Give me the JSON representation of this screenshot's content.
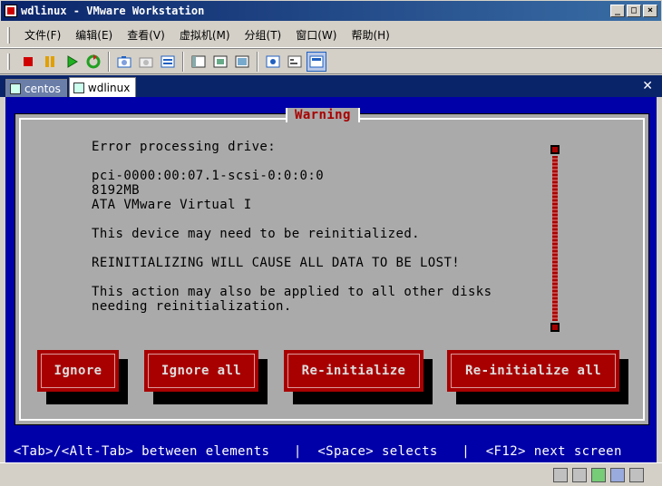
{
  "window": {
    "title": "wdlinux - VMware Workstation",
    "controls": [
      "_",
      "□",
      "×"
    ]
  },
  "menu": [
    "文件(F)",
    "编辑(E)",
    "查看(V)",
    "虚拟机(M)",
    "分组(T)",
    "窗口(W)",
    "帮助(H)"
  ],
  "toolbar": {
    "icons": [
      "power-off-icon",
      "suspend-icon",
      "power-on-icon",
      "reset-icon",
      "snapshot-icon",
      "revert-snapshot-icon",
      "snapshot-manager-icon",
      "normal-view-icon",
      "fullscreen-icon",
      "quick-switch-icon",
      "console-view-icon",
      "summary-view-icon",
      "appliance-view-icon"
    ]
  },
  "tabs": [
    {
      "label": "centos",
      "active": false
    },
    {
      "label": "wdlinux",
      "active": true
    }
  ],
  "console": {
    "dialog_title": "Warning",
    "lines": [
      "Error processing drive:",
      "pci-0000:00:07.1-scsi-0:0:0:0",
      "8192MB",
      "ATA VMware Virtual I",
      "This device may need to be reinitialized.",
      "REINITIALIZING WILL CAUSE ALL DATA TO BE LOST!",
      "This action may also be applied to all other disks",
      "needing reinitialization."
    ],
    "buttons": [
      "Ignore",
      "Ignore all",
      "Re-initialize",
      "Re-initialize all"
    ],
    "hint": " <Tab>/<Alt-Tab> between elements   |  <Space> selects   |  <F12> next screen"
  },
  "colors": {
    "console_bg": "#0000a8",
    "dialog_bg": "#aaaaaa",
    "accent_red": "#a80000"
  }
}
